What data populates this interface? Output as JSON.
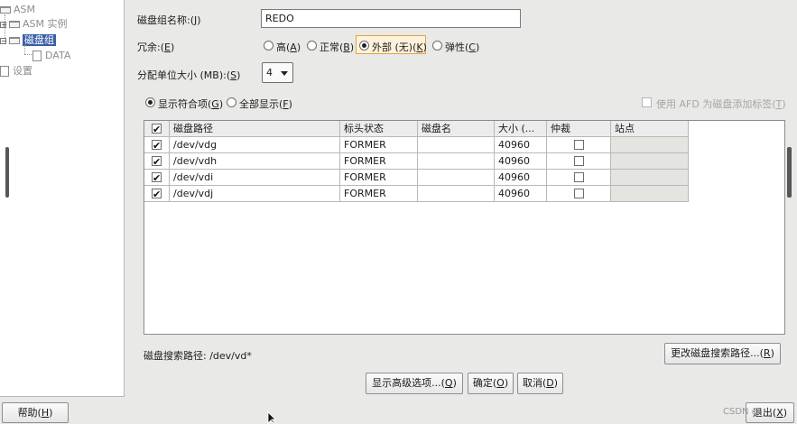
{
  "tree": {
    "root_label": "ASM",
    "instances_label": "ASM 实例",
    "diskgroups_label": "磁盘组",
    "data_label": "DATA",
    "settings_label": "设置"
  },
  "form": {
    "name_label": "磁盘组名称:(",
    "name_mnemonic": "J",
    "name_value": "REDO",
    "redundancy_label": "冗余:(",
    "redundancy_mnemonic": "E",
    "redundancy_options": [
      {
        "text": "高(",
        "mnemonic": "A",
        "selected": false
      },
      {
        "text": "正常(",
        "mnemonic": "B",
        "selected": false
      },
      {
        "text": "外部 (无)(",
        "mnemonic": "K",
        "selected": true
      },
      {
        "text": "弹性(",
        "mnemonic": "C",
        "selected": false
      }
    ],
    "alloc_label": "分配单位大小 (MB):(",
    "alloc_mnemonic": "S",
    "alloc_value": "4",
    "filter_show_matching": "显示符合项(",
    "filter_show_matching_mnemonic": "G",
    "filter_show_all": "全部显示(",
    "filter_show_all_mnemonic": "F",
    "afd_label": "使用 AFD 为磁盘添加标签(",
    "afd_mnemonic": "T"
  },
  "table": {
    "headers": [
      "磁盘路径",
      "标头状态",
      "磁盘名",
      "大小 (...",
      "仲裁",
      "站点"
    ],
    "rows": [
      {
        "checked": true,
        "path": "/dev/vdg",
        "header_status": "FORMER",
        "disk_name": "",
        "size": "40960",
        "quorum": false,
        "site": ""
      },
      {
        "checked": true,
        "path": "/dev/vdh",
        "header_status": "FORMER",
        "disk_name": "",
        "size": "40960",
        "quorum": false,
        "site": ""
      },
      {
        "checked": true,
        "path": "/dev/vdi",
        "header_status": "FORMER",
        "disk_name": "",
        "size": "40960",
        "quorum": false,
        "site": ""
      },
      {
        "checked": true,
        "path": "/dev/vdj",
        "header_status": "FORMER",
        "disk_name": "",
        "size": "40960",
        "quorum": false,
        "site": ""
      }
    ]
  },
  "search_path_text": "磁盘搜索路径: /dev/vd*",
  "buttons": {
    "change_path": "更改磁盘搜索路径...(",
    "change_path_mnemonic": "R",
    "advanced": "显示高级选项...(",
    "advanced_mnemonic": "Q",
    "ok": "确定(",
    "ok_mnemonic": "O",
    "cancel": "取消(",
    "cancel_mnemonic": "D",
    "help": "帮助(",
    "help_mnemonic": "H",
    "exit": "退出(",
    "exit_mnemonic": "X"
  },
  "watermark": "CSDN @"
}
